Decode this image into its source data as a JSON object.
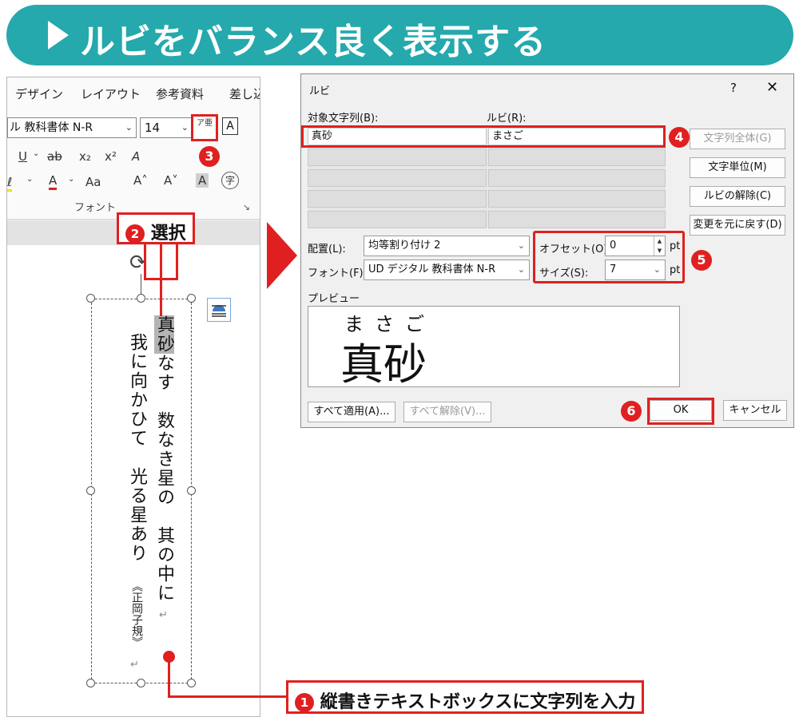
{
  "banner": {
    "title": "ルビをバランス良く表示する"
  },
  "word": {
    "tabs": [
      "デザイン",
      "レイアウト",
      "参考資料",
      "差し込"
    ],
    "font_name": "ル 教科書体 N-R",
    "font_size": "14",
    "ruby_button": "ア亜",
    "char_frame": "A",
    "row2": {
      "underline": "U",
      "strike": "ab",
      "subscript": "x₂",
      "superscript": "x²",
      "clear": "A"
    },
    "row3": {
      "highlight": "ℓ",
      "font_color": "A",
      "case": "Aa",
      "grow": "A˄",
      "shrink": "A˅",
      "shade": "A",
      "enclose": "字"
    },
    "group_label": "フォント",
    "launcher": "↘",
    "poem": {
      "col1_rest": "なす　数なき星の　其の中に",
      "col1_selected": "真砂",
      "col2": "我に向かひて　光る星あり",
      "attribution": "《正岡子規》"
    },
    "return_mark": "↵"
  },
  "callouts": {
    "c1": {
      "num": "1",
      "text": "縦書きテキストボックスに文字列を入力"
    },
    "c2": {
      "num": "2",
      "text": "選択"
    },
    "c3": {
      "num": "3"
    },
    "c4": {
      "num": "4"
    },
    "c5": {
      "num": "5"
    },
    "c6": {
      "num": "6"
    }
  },
  "dialog": {
    "title": "ルビ",
    "help": "?",
    "close": "✕",
    "target_label": "対象文字列(B):",
    "ruby_label": "ルビ(R):",
    "target_value": "真砂",
    "ruby_value": "まさご",
    "buttons": {
      "whole": "文字列全体(G)",
      "per_char": "文字単位(M)",
      "clear_ruby": "ルビの解除(C)",
      "restore": "変更を元に戻す(D)",
      "apply_all": "すべて適用(A)...",
      "clear_all": "すべて解除(V)...",
      "ok": "OK",
      "cancel": "キャンセル"
    },
    "alignment_label": "配置(L):",
    "alignment_value": "均等割り付け 2",
    "font_label": "フォント(F):",
    "font_value": "UD デジタル 教科書体 N-R",
    "offset_label": "オフセット(O):",
    "offset_value": "0",
    "size_label": "サイズ(S):",
    "size_value": "7",
    "unit": "pt",
    "preview_label": "プレビュー",
    "preview_ruby": "まさご",
    "preview_base": "真砂"
  },
  "colors": {
    "banner": "#25a9ad",
    "accent": "#e02020"
  }
}
